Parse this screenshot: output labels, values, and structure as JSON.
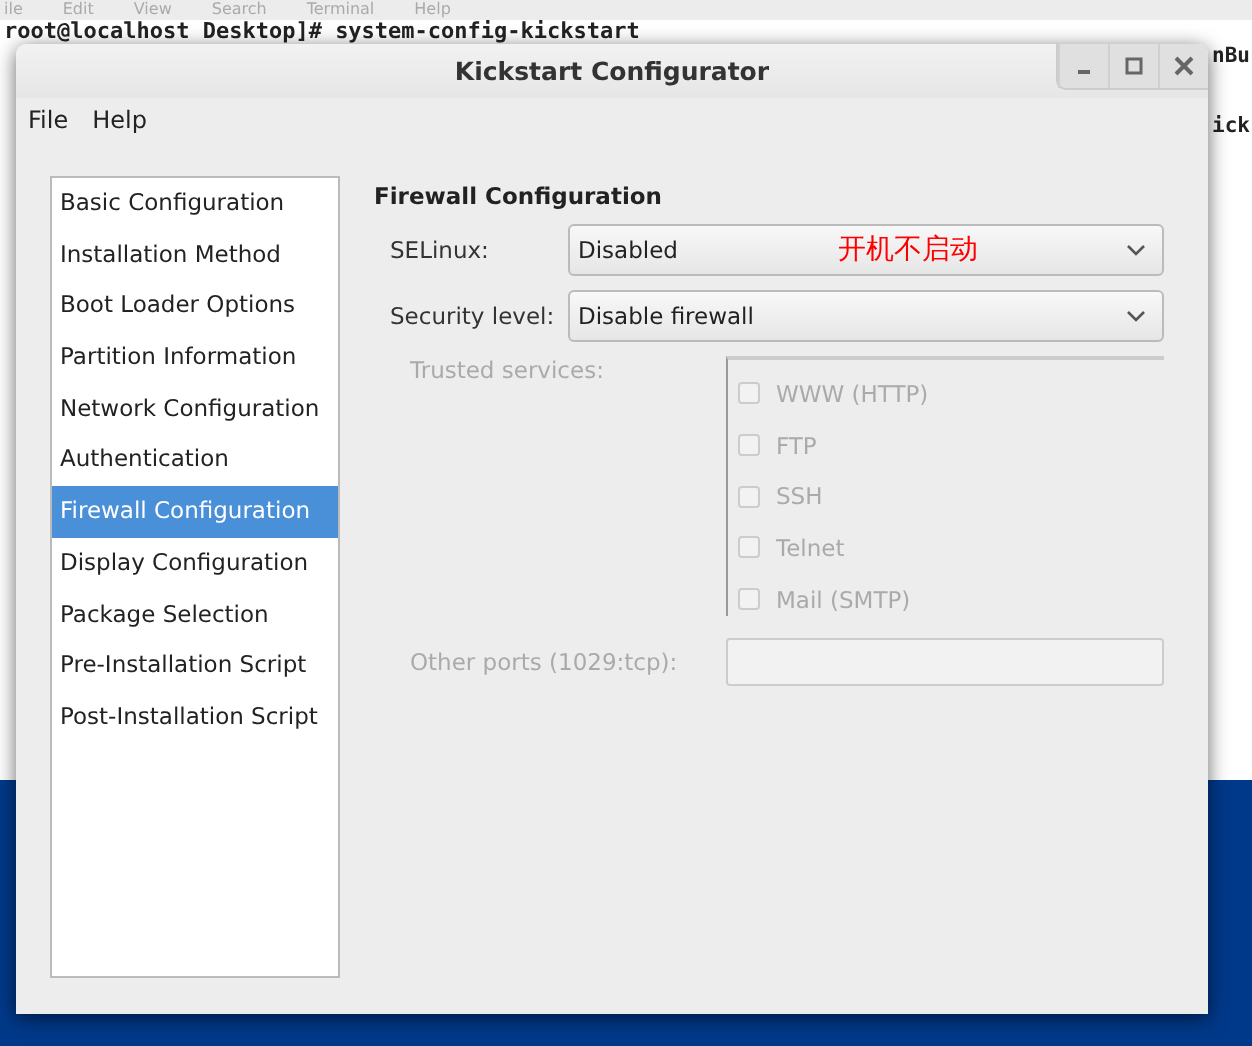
{
  "terminal": {
    "menu": [
      "ile",
      "Edit",
      "View",
      "Search",
      "Terminal",
      "Help"
    ],
    "prompt": "root@localhost Desktop]# system-config-kickstart",
    "right_fragments": [
      "nBu",
      "ick"
    ]
  },
  "window": {
    "title": "Kickstart Configurator"
  },
  "menu": [
    "File",
    "Help"
  ],
  "sidebar": {
    "items": [
      {
        "label": "Basic Configuration",
        "selected": false
      },
      {
        "label": "Installation Method",
        "selected": false
      },
      {
        "label": "Boot Loader Options",
        "selected": false
      },
      {
        "label": "Partition Information",
        "selected": false
      },
      {
        "label": "Network Configuration",
        "selected": false
      },
      {
        "label": "Authentication",
        "selected": false
      },
      {
        "label": "Firewall Configuration",
        "selected": true
      },
      {
        "label": "Display Configuration",
        "selected": false
      },
      {
        "label": "Package Selection",
        "selected": false
      },
      {
        "label": "Pre-Installation Script",
        "selected": false
      },
      {
        "label": "Post-Installation Script",
        "selected": false
      }
    ]
  },
  "panel": {
    "heading": "Firewall Configuration",
    "selinux": {
      "label": "SELinux:",
      "value": "Disabled",
      "annotation": "开机不启动"
    },
    "security_level": {
      "label": "Security level:",
      "value": "Disable firewall"
    },
    "trusted_services": {
      "label": "Trusted services:",
      "disabled": true,
      "items": [
        {
          "label": "WWW (HTTP)",
          "checked": false
        },
        {
          "label": "FTP",
          "checked": false
        },
        {
          "label": "SSH",
          "checked": false
        },
        {
          "label": "Telnet",
          "checked": false
        },
        {
          "label": "Mail (SMTP)",
          "checked": false
        }
      ]
    },
    "other_ports": {
      "label": "Other ports (1029:tcp):",
      "disabled": true
    }
  }
}
